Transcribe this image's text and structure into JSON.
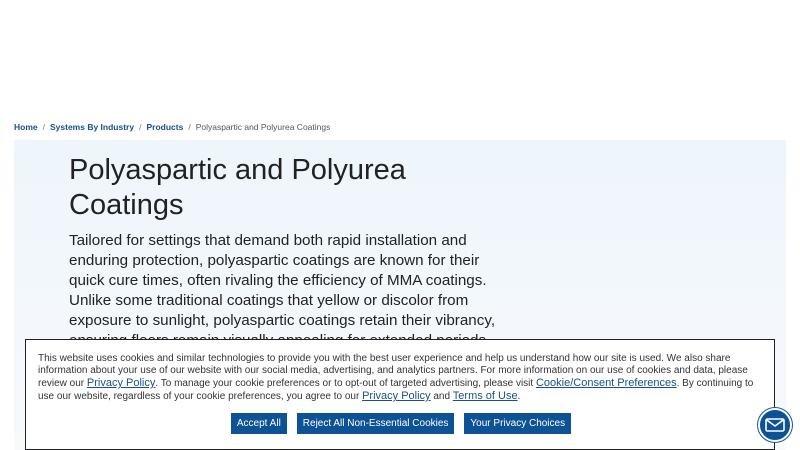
{
  "breadcrumb": {
    "items": [
      "Home",
      "Systems By Industry",
      "Products"
    ],
    "current": "Polyaspartic and Polyurea Coatings"
  },
  "hero": {
    "title": "Polyaspartic and Polyurea Coatings",
    "description": "Tailored for settings that demand both rapid installation and enduring protection, polyaspartic coatings are known for their quick cure times, often rivaling the efficiency of MMA coatings. Unlike some traditional coatings that yellow or discolor from exposure to sunlight, polyaspartic coatings retain their vibrancy, ensuring floors remain visually appealing for extended periods. Sherwin-Williams"
  },
  "cookie": {
    "text1": "This website uses cookies and similar technologies to provide you with the best user experience and help us understand how our site is used. We also share information about your use of our website with our social media, advertising, and analytics partners. For more information on our use of cookies and data, please review our ",
    "link1": "Privacy Policy",
    "text2": ". To manage your cookie preferences or to opt-out of targeted advertising, please visit ",
    "link2": "Cookie/Consent Preferences",
    "text3": ". By continuing to use our website, regardless of your cookie preferences, you agree to our ",
    "link3": "Privacy Policy",
    "text4": " and ",
    "link4": "Terms of Use",
    "text5": ".",
    "buttons": {
      "accept": "Accept All",
      "reject": "Reject All Non-Essential Cookies",
      "choices": "Your Privacy Choices"
    }
  },
  "chat": {
    "icon": "envelope-icon"
  },
  "colors": {
    "primary": "#0e5296",
    "link": "#1a4f8b"
  }
}
